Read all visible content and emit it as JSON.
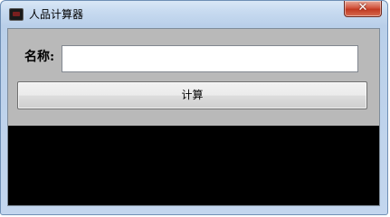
{
  "window": {
    "title": "人品计算器",
    "close_symbol": "✕"
  },
  "form": {
    "name_label": "名称:",
    "name_value": "",
    "calculate_label": "计算"
  },
  "output": {
    "text": ""
  },
  "colors": {
    "panel_background": "#b9b9b9",
    "output_background": "#000000",
    "close_button": "#c23a22"
  }
}
